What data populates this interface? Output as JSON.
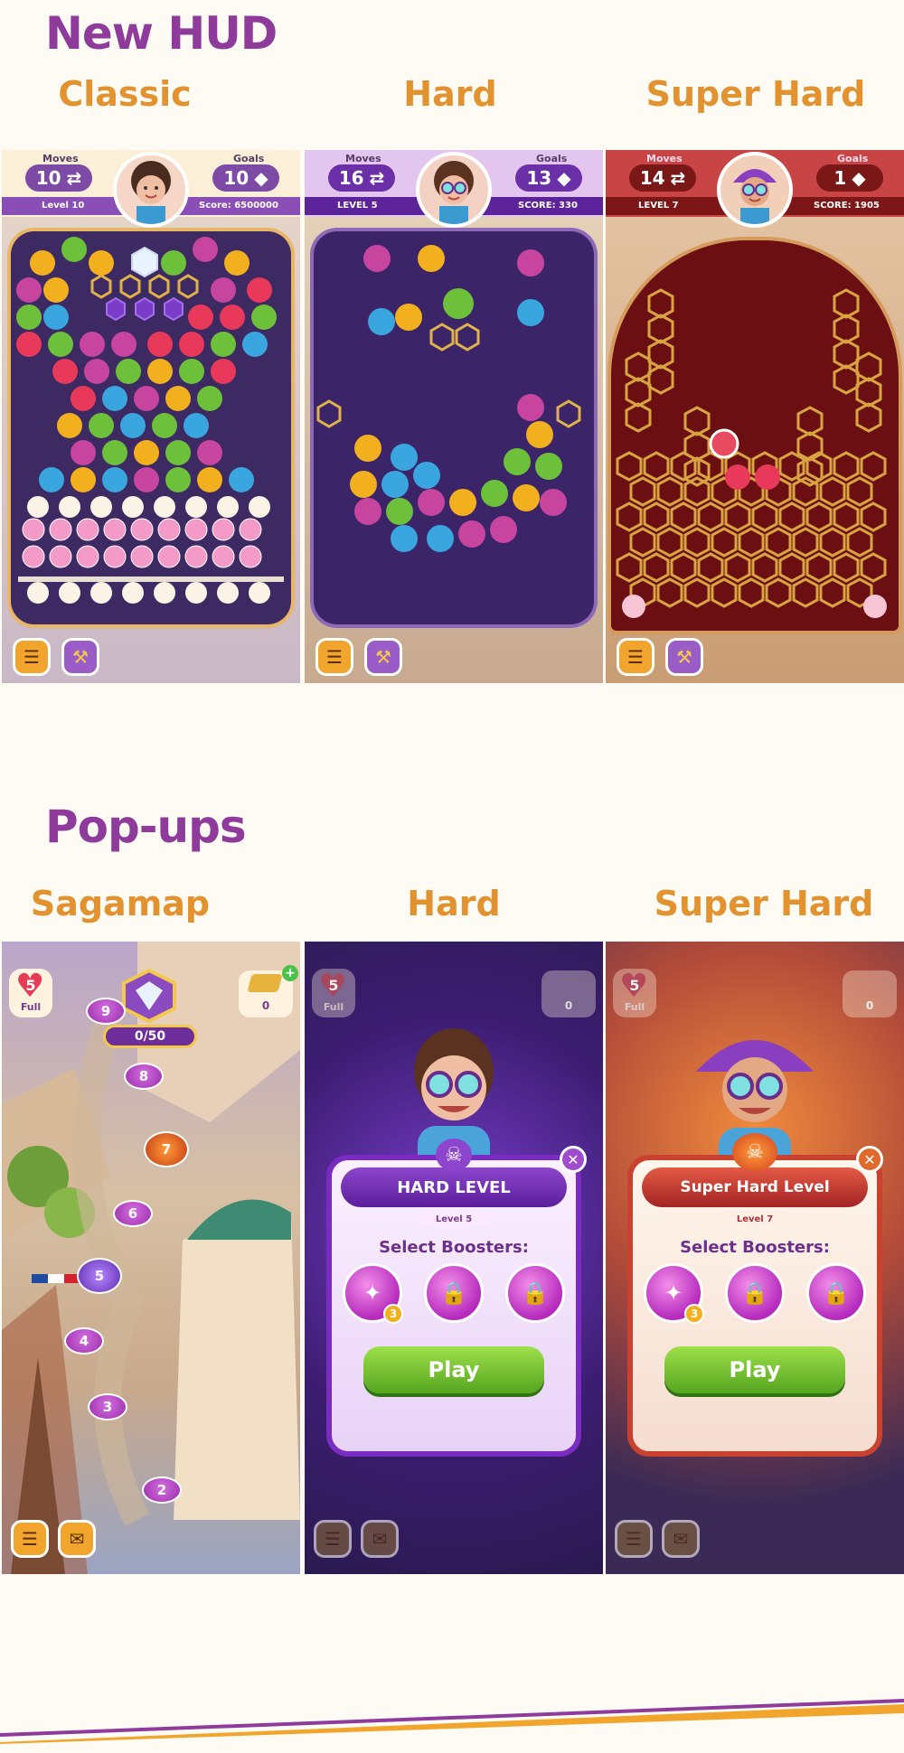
{
  "sections": {
    "hud_title": "New HUD",
    "popups_title": "Pop-ups"
  },
  "hud_panels": [
    {
      "title": "Classic",
      "moves_label": "Moves",
      "moves": "10",
      "goals_label": "Goals",
      "goals": "10",
      "level": "Level 10",
      "score": "Score: 6500000"
    },
    {
      "title": "Hard",
      "moves_label": "Moves",
      "moves": "16",
      "goals_label": "Goals",
      "goals": "13",
      "level": "LEVEL 5",
      "score": "SCORE: 330"
    },
    {
      "title": "Super Hard",
      "moves_label": "Moves",
      "moves": "14",
      "goals_label": "Goals",
      "goals": "1",
      "level": "LEVEL 7",
      "score": "SCORE: 1905"
    }
  ],
  "popup_panels": [
    {
      "title": "Sagamap",
      "lives": "5",
      "lives_status": "Full",
      "coins": "0",
      "goal_progress": "0/50",
      "level_nodes": [
        "9",
        "8",
        "7",
        "6",
        "5",
        "4",
        "3",
        "2"
      ]
    },
    {
      "title": "Hard",
      "lives": "5",
      "lives_status": "Full",
      "coins": "0",
      "level_title": "HARD LEVEL",
      "level_sub": "Level 5",
      "select_boosters": "Select Boosters:",
      "booster_count": "3",
      "play_label": "Play",
      "close_label": "✕"
    },
    {
      "title": "Super Hard",
      "lives": "5",
      "lives_status": "Full",
      "coins": "0",
      "level_title": "Super Hard Level",
      "level_sub": "Level 7",
      "select_boosters": "Select Boosters:",
      "booster_count": "3",
      "play_label": "Play",
      "close_label": "✕"
    }
  ],
  "icons": {
    "menu": "menu-icon",
    "hammer": "hammer-booster-icon",
    "mail": "mail-icon",
    "lock": "lock-icon",
    "heart": "heart-icon"
  },
  "colors": {
    "heading_purple": "#8f3b9c",
    "heading_orange": "#e2922e",
    "hard_purple": "#6b2fa8",
    "super_hard_red": "#9b2424",
    "play_green": "#6cc22f"
  }
}
